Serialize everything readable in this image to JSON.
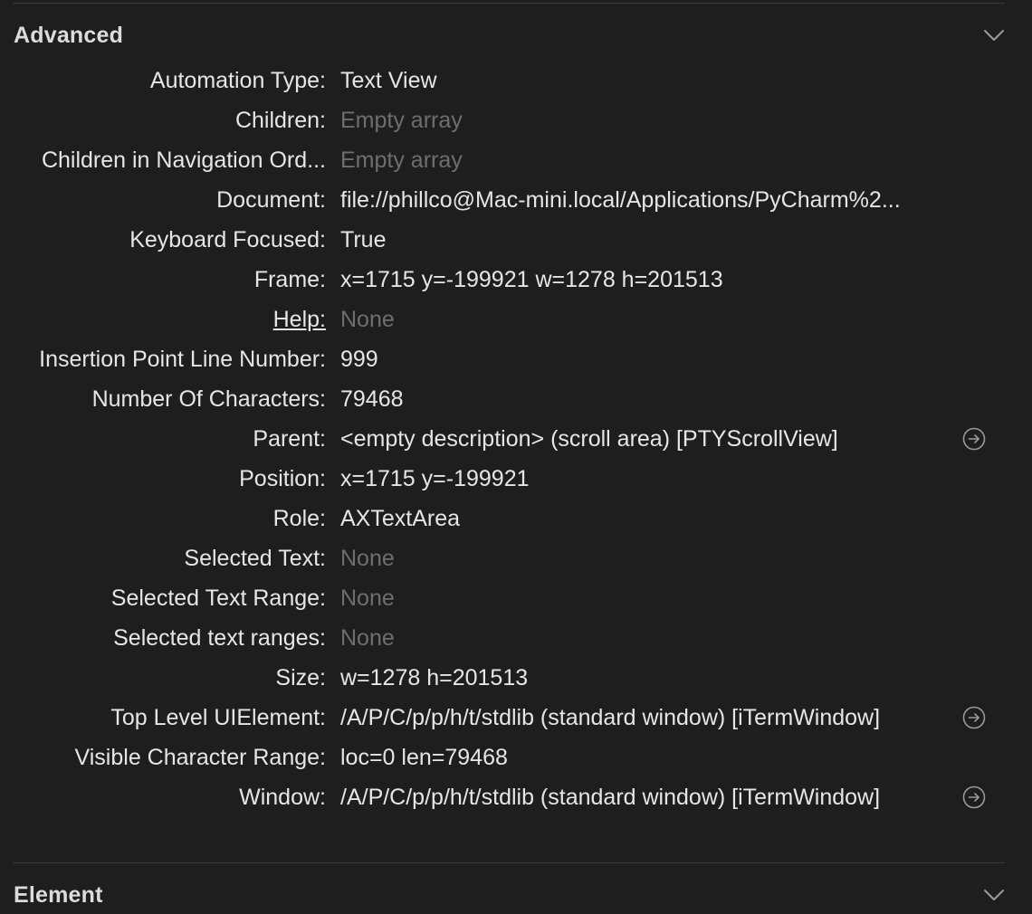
{
  "advanced": {
    "title": "Advanced",
    "toggle_icon": "chevron-down-icon",
    "rows": [
      {
        "label": "Automation Type:",
        "value": "Text View",
        "muted": false
      },
      {
        "label": "Children:",
        "value": "Empty array",
        "muted": true
      },
      {
        "label": "Children in Navigation Ord...",
        "value": "Empty array",
        "muted": true
      },
      {
        "label": "Document:",
        "value": "file://phillco@Mac-mini.local/Applications/PyCharm%2...",
        "muted": false
      },
      {
        "label": "Keyboard Focused:",
        "value": "True",
        "muted": false
      },
      {
        "label": "Frame:",
        "value": "x=1715 y=-199921 w=1278 h=201513",
        "muted": false
      },
      {
        "label": "Help:",
        "value": "None",
        "muted": true
      },
      {
        "label": "Insertion Point Line Number:",
        "value": "999",
        "muted": false
      },
      {
        "label": "Number Of Characters:",
        "value": "79468",
        "muted": false
      },
      {
        "label": "Parent:",
        "value": "<empty description> (scroll area) [PTYScrollView]",
        "muted": false
      },
      {
        "label": "Position:",
        "value": "x=1715 y=-199921",
        "muted": false
      },
      {
        "label": "Role:",
        "value": "AXTextArea",
        "muted": false
      },
      {
        "label": "Selected Text:",
        "value": "None",
        "muted": true
      },
      {
        "label": "Selected Text Range:",
        "value": "None",
        "muted": true
      },
      {
        "label": "Selected text ranges:",
        "value": "None",
        "muted": true
      },
      {
        "label": "Size:",
        "value": "w=1278 h=201513",
        "muted": false
      },
      {
        "label": "Top Level UIElement:",
        "value": "/A/P/C/p/p/h/t/stdlib (standard window) [iTermWindow]",
        "muted": false
      },
      {
        "label": "Visible Character Range:",
        "value": "loc=0 len=79468",
        "muted": false
      },
      {
        "label": "Window:",
        "value": "/A/P/C/p/p/h/t/stdlib (standard window) [iTermWindow]",
        "muted": false
      }
    ]
  },
  "element": {
    "title": "Element",
    "toggle_icon": "chevron-down-icon"
  },
  "colors": {
    "background": "#1e1e1e",
    "text": "#e6e6e6",
    "muted_text": "#6e6e6e",
    "divider": "#3a3a3a"
  }
}
